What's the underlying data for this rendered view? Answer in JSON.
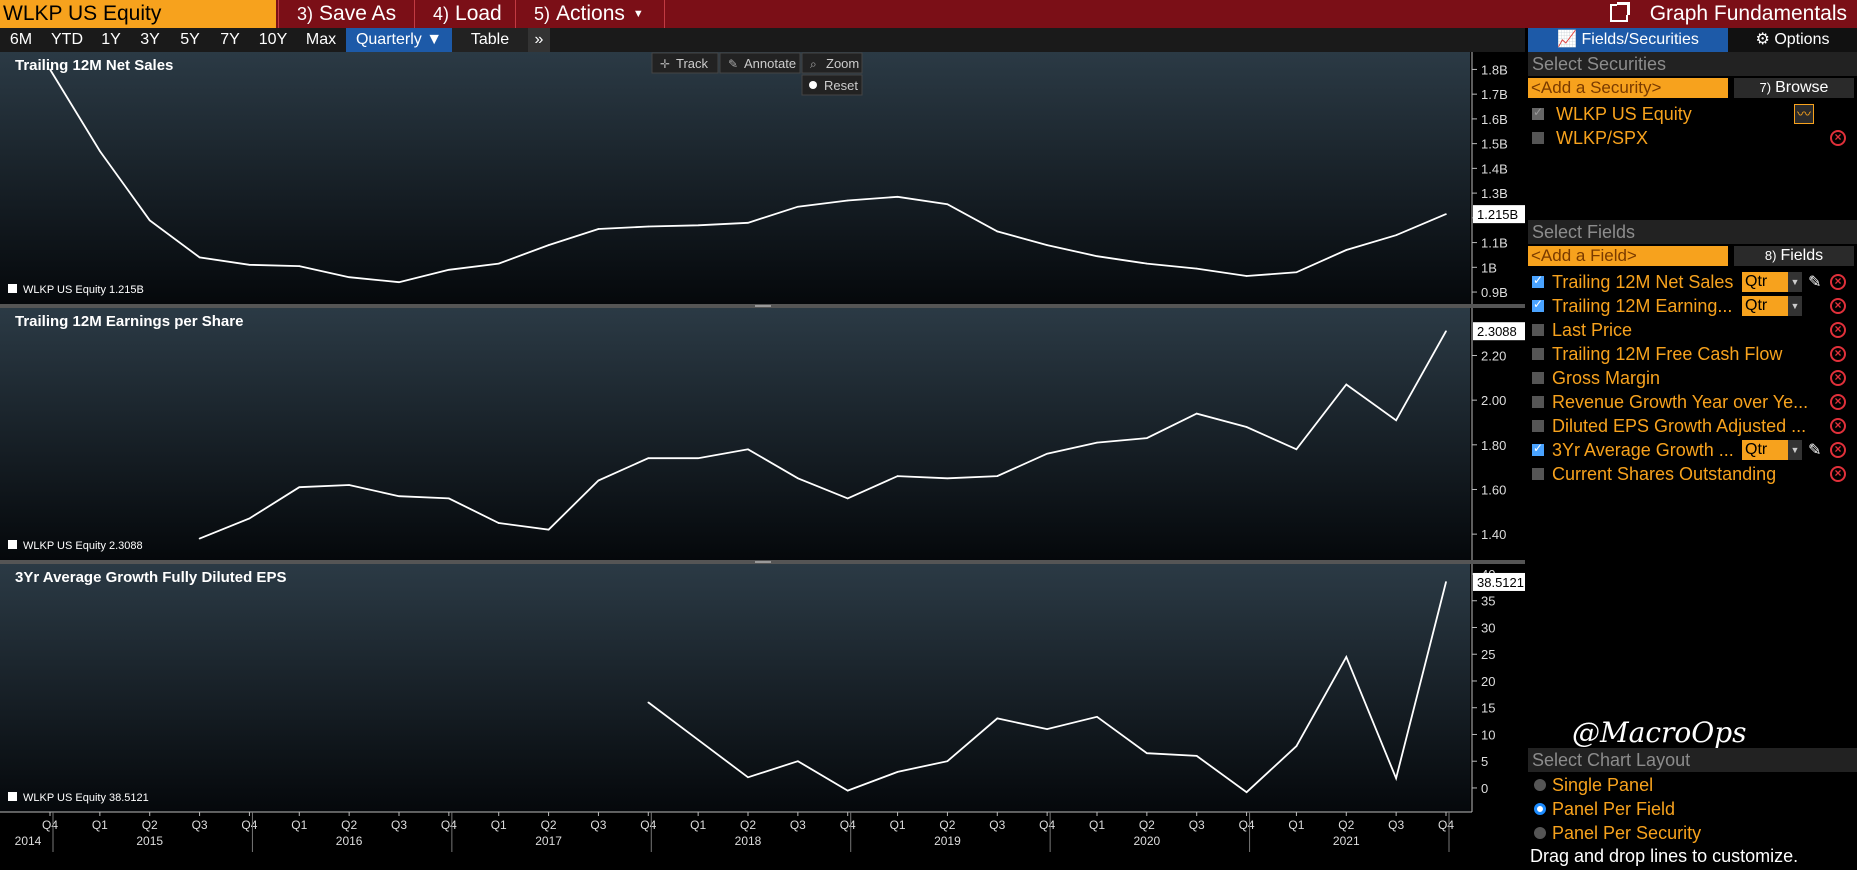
{
  "top_bar": {
    "ticker": "WLKP US Equity",
    "save_as": {
      "num": "3)",
      "label": "Save As"
    },
    "load": {
      "num": "4)",
      "label": "Load"
    },
    "actions": {
      "num": "5)",
      "label": "Actions"
    },
    "graph_fundamentals": "Graph Fundamentals"
  },
  "toolbar": {
    "ranges": [
      "6M",
      "YTD",
      "1Y",
      "3Y",
      "5Y",
      "7Y",
      "10Y",
      "Max"
    ],
    "quarterly": "Quarterly ▼",
    "table": "Table",
    "more": "»",
    "track": "Track",
    "annotate": "Annotate",
    "zoom": "Zoom",
    "reset": "Reset"
  },
  "right_tabs": {
    "fields_securities": "Fields/Securities",
    "options": "Options"
  },
  "securities": {
    "header": "Select Securities",
    "add_placeholder": "<Add a Security>",
    "browse": {
      "num": "7)",
      "label": "Browse"
    },
    "items": [
      {
        "label": "WLKP US Equity",
        "checked": true
      },
      {
        "label": "WLKP/SPX",
        "checked": false
      }
    ]
  },
  "fields": {
    "header": "Select Fields",
    "add_placeholder": "<Add a Field>",
    "fields_btn": {
      "num": "8)",
      "label": "Fields"
    },
    "items": [
      {
        "label": "Trailing 12M Net Sales",
        "checked": true,
        "period": "Qtr"
      },
      {
        "label": "Trailing 12M Earning...",
        "checked": true,
        "period": "Qtr"
      },
      {
        "label": "Last Price",
        "checked": false
      },
      {
        "label": "Trailing 12M Free Cash Flow",
        "checked": false
      },
      {
        "label": "Gross Margin",
        "checked": false
      },
      {
        "label": "Revenue Growth Year over Ye...",
        "checked": false
      },
      {
        "label": "Diluted EPS Growth Adjusted ...",
        "checked": false
      },
      {
        "label": "3Yr Average Growth ...",
        "checked": true,
        "period": "Qtr"
      },
      {
        "label": "Current Shares Outstanding",
        "checked": false
      }
    ]
  },
  "layout": {
    "header": "Select Chart Layout",
    "options": [
      {
        "label": "Single Panel",
        "selected": false
      },
      {
        "label": "Panel Per Field",
        "selected": true
      },
      {
        "label": "Panel Per Security",
        "selected": false
      }
    ],
    "help": "Drag and drop lines to customize."
  },
  "watermark": "@MacroOps",
  "colors": {
    "accent": "#f7a21d",
    "topbar": "#7b0f17",
    "selected_blue": "#1d5aa8",
    "line": "#ffffff",
    "remove": "#e0303a"
  },
  "chart_data": [
    {
      "type": "line",
      "title": "Trailing 12M Net Sales",
      "legend": "WLKP US Equity",
      "legend_value": "1.215B",
      "last_value_label": "1.215B",
      "y_ticks": [
        "1.8B",
        "1.7B",
        "1.6B",
        "1.5B",
        "1.4B",
        "1.3B",
        "1.2B",
        "1.1B",
        "1B",
        "0.9B"
      ],
      "ylim": [
        0.88,
        1.83
      ],
      "x": [
        0,
        1,
        2,
        3,
        4,
        5,
        6,
        7,
        8,
        9,
        10,
        11,
        12,
        13,
        14,
        15,
        16,
        17,
        18,
        19,
        20,
        21,
        22,
        23,
        24,
        25,
        26,
        27,
        28
      ],
      "values": [
        1.8,
        1.47,
        1.19,
        1.04,
        1.01,
        1.005,
        0.96,
        0.94,
        0.99,
        1.015,
        1.09,
        1.155,
        1.165,
        1.17,
        1.18,
        1.245,
        1.27,
        1.285,
        1.255,
        1.145,
        1.09,
        1.045,
        1.015,
        0.995,
        0.965,
        0.98,
        1.07,
        1.13,
        1.215
      ]
    },
    {
      "type": "line",
      "title": "Trailing 12M Earnings per Share",
      "legend": "WLKP US Equity",
      "legend_value": "2.3088",
      "last_value_label": "2.3088",
      "y_ticks": [
        "2.20",
        "2.00",
        "1.80",
        "1.60",
        "1.40"
      ],
      "ylim": [
        1.32,
        2.35
      ],
      "x": [
        3,
        4,
        5,
        6,
        7,
        8,
        9,
        10,
        11,
        12,
        13,
        14,
        15,
        16,
        17,
        18,
        19,
        20,
        21,
        22,
        23,
        24,
        25,
        26,
        27,
        28
      ],
      "values": [
        1.38,
        1.47,
        1.61,
        1.62,
        1.57,
        1.56,
        1.45,
        1.42,
        1.64,
        1.74,
        1.74,
        1.78,
        1.65,
        1.56,
        1.66,
        1.65,
        1.66,
        1.76,
        1.81,
        1.83,
        1.94,
        1.88,
        1.78,
        2.07,
        1.91,
        2.3088
      ]
    },
    {
      "type": "line",
      "title": "3Yr Average Growth Fully Diluted EPS",
      "legend": "WLKP US Equity",
      "legend_value": "38.5121",
      "last_value_label": "38.5121",
      "y_ticks": [
        "40",
        "35",
        "30",
        "25",
        "20",
        "15",
        "10",
        "5",
        "0"
      ],
      "ylim": [
        -3,
        40
      ],
      "x": [
        12,
        13,
        14,
        15,
        16,
        17,
        18,
        19,
        20,
        21,
        22,
        23,
        24,
        25,
        26,
        27,
        28
      ],
      "values": [
        16,
        9,
        2,
        5,
        -0.5,
        3,
        5,
        13,
        11,
        13.3,
        6.5,
        6,
        -0.8,
        7.8,
        24.5,
        1.8,
        38.5121
      ]
    }
  ],
  "x_axis": {
    "quarter_labels": [
      "Q4",
      "Q1",
      "Q2",
      "Q3",
      "Q4",
      "Q1",
      "Q2",
      "Q3",
      "Q4",
      "Q1",
      "Q2",
      "Q3",
      "Q4",
      "Q1",
      "Q2",
      "Q3",
      "Q4",
      "Q1",
      "Q2",
      "Q3",
      "Q4",
      "Q1",
      "Q2",
      "Q3",
      "Q4",
      "Q1",
      "Q2",
      "Q3",
      "Q4"
    ],
    "year_labels": [
      {
        "idx": 0,
        "label": "2014"
      },
      {
        "idx": 2,
        "label": "2015"
      },
      {
        "idx": 6,
        "label": "2016"
      },
      {
        "idx": 10,
        "label": "2017"
      },
      {
        "idx": 14,
        "label": "2018"
      },
      {
        "idx": 18,
        "label": "2019"
      },
      {
        "idx": 22,
        "label": "2020"
      },
      {
        "idx": 26,
        "label": "2021"
      }
    ]
  }
}
